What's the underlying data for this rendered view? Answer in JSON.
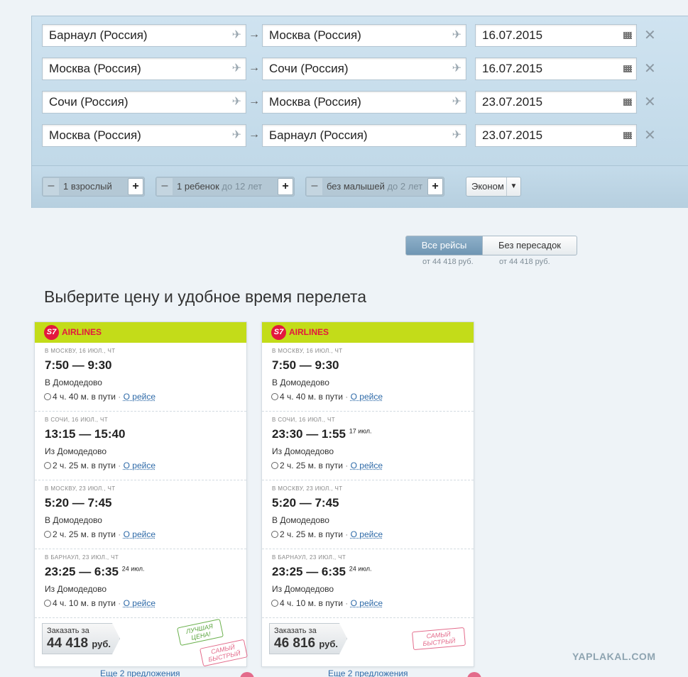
{
  "routes": [
    {
      "from": "Барнаул (Россия)",
      "to": "Москва (Россия)",
      "date": "16.07.2015"
    },
    {
      "from": "Москва (Россия)",
      "to": "Сочи (Россия)",
      "date": "16.07.2015"
    },
    {
      "from": "Сочи (Россия)",
      "to": "Москва (Россия)",
      "date": "23.07.2015"
    },
    {
      "from": "Москва (Россия)",
      "to": "Барнаул (Россия)",
      "date": "23.07.2015"
    }
  ],
  "passengers": {
    "adults": "1 взрослый",
    "children": "1 ребенок",
    "children_note": "до 12 лет",
    "infants": "без малышей",
    "infants_note": "до 2 лет",
    "minus": "–",
    "plus": "+"
  },
  "cabin_class": "Эконом",
  "filters": {
    "all_label": "Все рейсы",
    "all_price": "от 44 418 руб.",
    "direct_label": "Без пересадок",
    "direct_price": "от 44 418 руб."
  },
  "heading": "Выберите цену и удобное время перелета",
  "offers": [
    {
      "airline": "AIRLINES",
      "logo": "S7",
      "segments": [
        {
          "dir": "в Москву, 16 июл., чт",
          "time": "7:50 — 9:30",
          "sup": "",
          "airport": "В Домодедово",
          "duration": "4 ч. 40 м. в пути",
          "link": "О рейсе"
        },
        {
          "dir": "в Сочи, 16 июл., чт",
          "time": "13:15 — 15:40",
          "sup": "",
          "airport": "Из Домодедово",
          "duration": "2 ч. 25 м. в пути",
          "link": "О рейсе"
        },
        {
          "dir": "в Москву, 23 июл., чт",
          "time": "5:20 — 7:45",
          "sup": "",
          "airport": "В Домодедово",
          "duration": "2 ч. 25 м. в пути",
          "link": "О рейсе"
        },
        {
          "dir": "в Барнаул, 23 июл., чт",
          "time": "23:25 — 6:35",
          "sup": "24 июл.",
          "airport": "Из Домодедово",
          "duration": "4 ч. 10 м. в пути",
          "link": "О рейсе"
        }
      ],
      "book_label": "Заказать за",
      "price": "44 418",
      "currency": "руб.",
      "stamp_best": "Лучшая цена!",
      "stamp_fast": "Самый быстрый",
      "more": "Еще 2 предложения"
    },
    {
      "airline": "AIRLINES",
      "logo": "S7",
      "segments": [
        {
          "dir": "в Москву, 16 июл., чт",
          "time": "7:50 — 9:30",
          "sup": "",
          "airport": "В Домодедово",
          "duration": "4 ч. 40 м. в пути",
          "link": "О рейсе"
        },
        {
          "dir": "в Сочи, 16 июл., чт",
          "time": "23:30 — 1:55",
          "sup": "17 июл.",
          "airport": "Из Домодедово",
          "duration": "2 ч. 25 м. в пути",
          "link": "О рейсе"
        },
        {
          "dir": "в Москву, 23 июл., чт",
          "time": "5:20 — 7:45",
          "sup": "",
          "airport": "В Домодедово",
          "duration": "2 ч. 25 м. в пути",
          "link": "О рейсе"
        },
        {
          "dir": "в Барнаул, 23 июл., чт",
          "time": "23:25 — 6:35",
          "sup": "24 июл.",
          "airport": "Из Домодедово",
          "duration": "4 ч. 10 м. в пути",
          "link": "О рейсе"
        }
      ],
      "book_label": "Заказать за",
      "price": "46 816",
      "currency": "руб.",
      "stamp_fast": "Самый быстрый",
      "more": "Еще 2 предложения"
    }
  ],
  "watermark": "YAPLAKAL.COM",
  "colors": {
    "accent_green": "#c3dc19",
    "brand_red": "#e3173e",
    "link_blue": "#2e6aa8"
  }
}
